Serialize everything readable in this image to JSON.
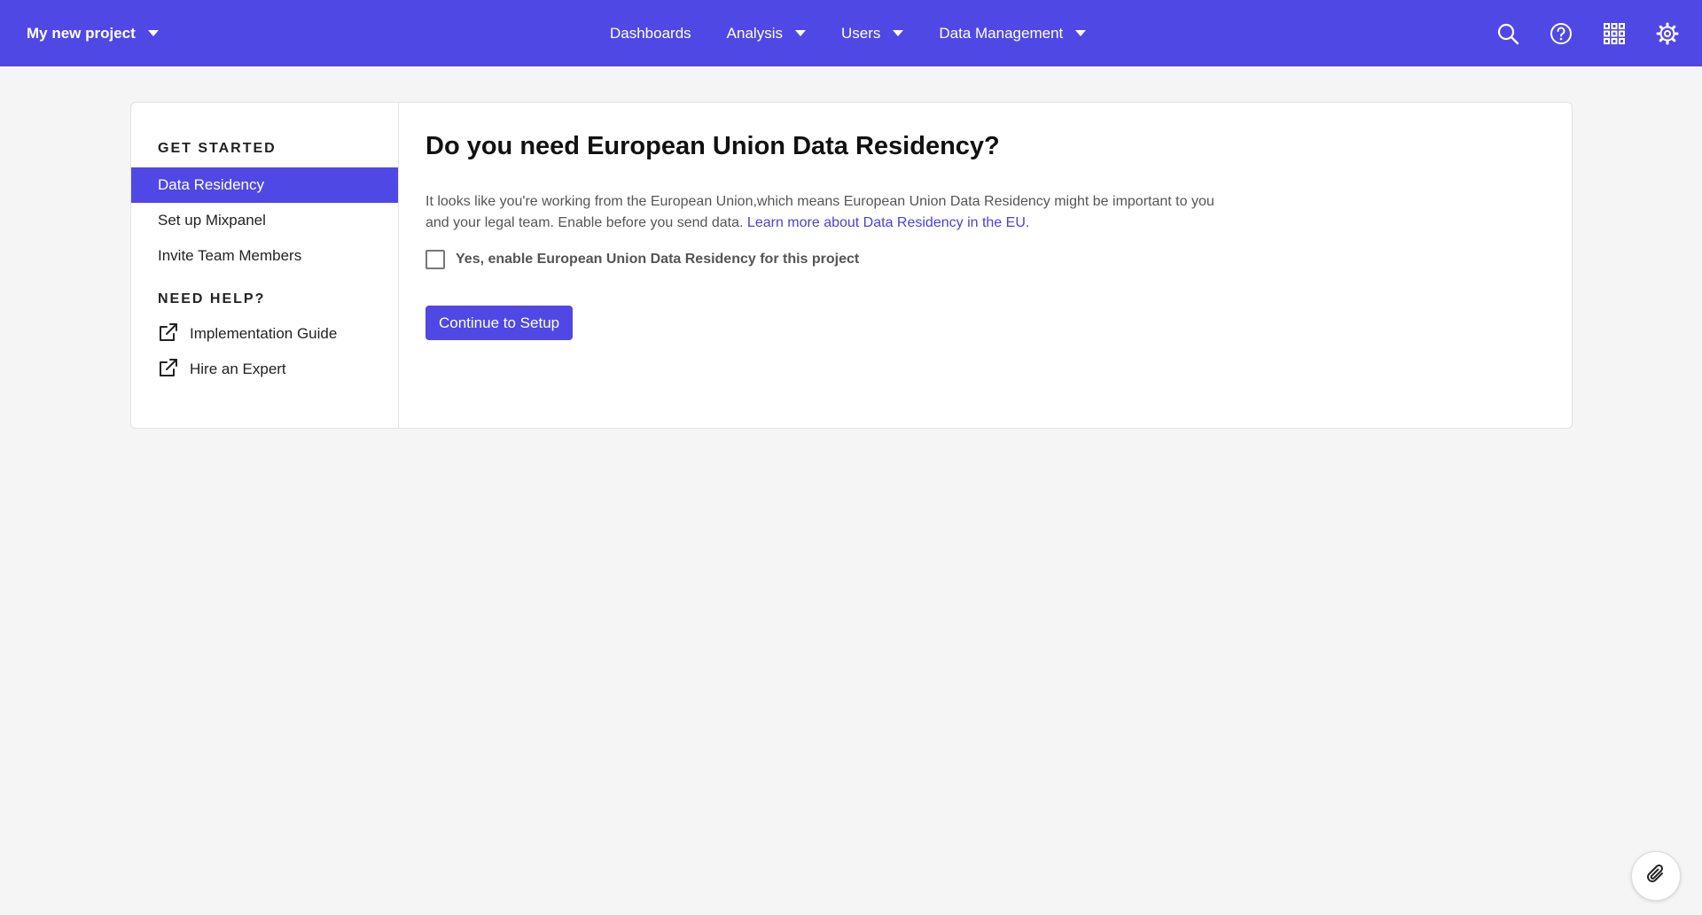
{
  "colors": {
    "brand": "#5048e5",
    "link": "#4a42d6",
    "page_bg": "#f5f5f5"
  },
  "topnav": {
    "project_name": "My new project",
    "links": [
      {
        "label": "Dashboards",
        "has_dropdown": false
      },
      {
        "label": "Analysis",
        "has_dropdown": true
      },
      {
        "label": "Users",
        "has_dropdown": true
      },
      {
        "label": "Data Management",
        "has_dropdown": true
      }
    ],
    "icons": [
      "search-icon",
      "help-icon",
      "apps-grid-icon",
      "settings-gear-icon"
    ]
  },
  "sidebar": {
    "get_started_title": "GET STARTED",
    "items": [
      {
        "label": "Data Residency",
        "active": true
      },
      {
        "label": "Set up Mixpanel",
        "active": false
      },
      {
        "label": "Invite Team Members",
        "active": false
      }
    ],
    "help_title": "NEED HELP?",
    "help_items": [
      {
        "label": "Implementation Guide",
        "icon": "external-link-icon"
      },
      {
        "label": "Hire an Expert",
        "icon": "external-link-icon"
      }
    ]
  },
  "main": {
    "heading": "Do you need European Union Data Residency?",
    "description": "It looks like you're working from the European Union,which means European Union Data Residency might be important to you and your legal team. Enable before you send data.",
    "learn_more_link": "Learn more about Data Residency in the EU.",
    "checkbox_label": "Yes, enable European Union Data Residency for this project",
    "checkbox_checked": false,
    "continue_button": "Continue to Setup"
  },
  "fab_icon": "paperclip-icon"
}
